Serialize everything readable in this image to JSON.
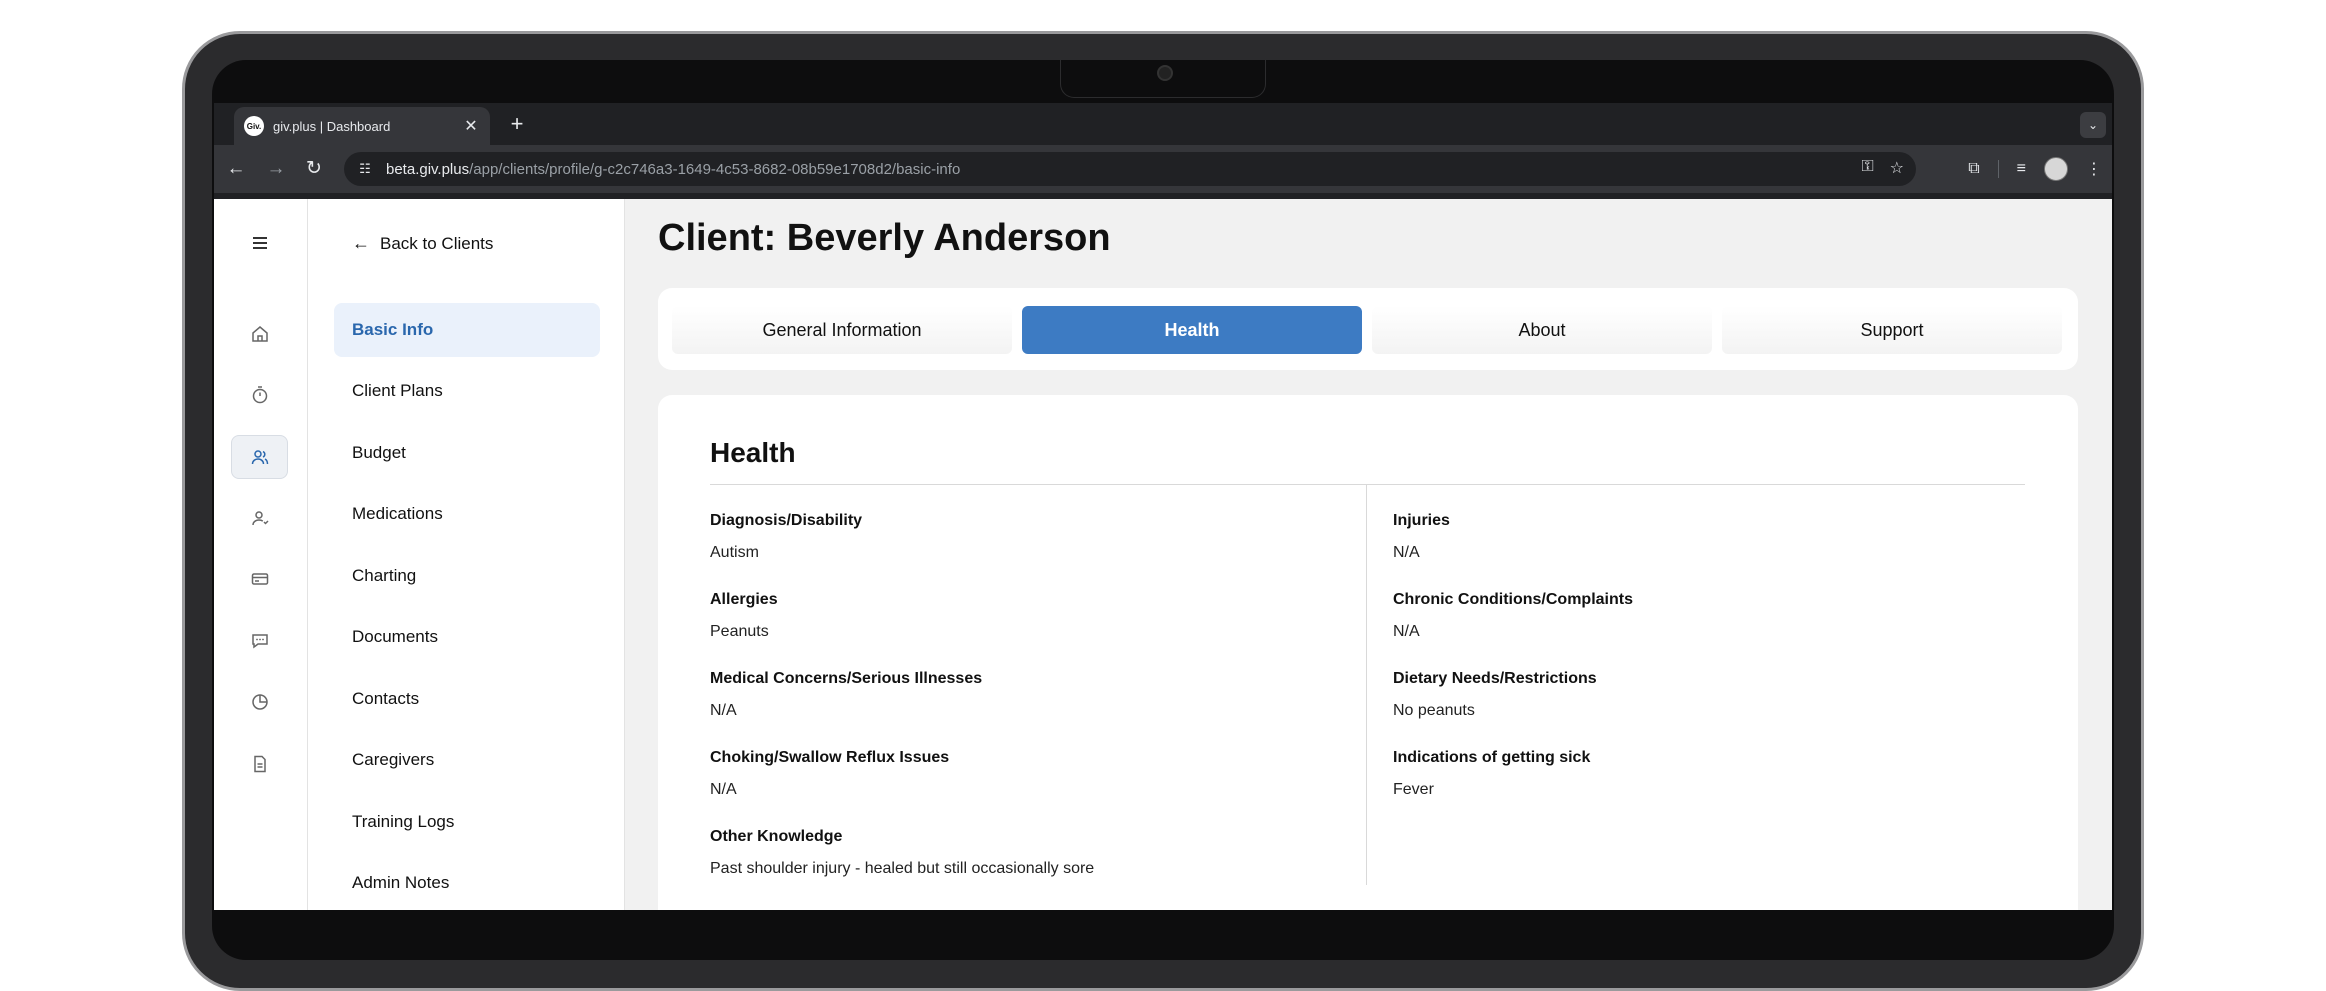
{
  "browser": {
    "tab_title": "giv.plus | Dashboard",
    "favicon_text": "Giv.",
    "url_host": "beta.giv.plus",
    "url_path": "/app/clients/profile/g-c2c746a3-1649-4c53-8682-08b59e1708d2/basic-info"
  },
  "subnav": {
    "back_label": "Back to Clients",
    "items": [
      {
        "label": "Basic Info",
        "active": true
      },
      {
        "label": "Client Plans"
      },
      {
        "label": "Budget"
      },
      {
        "label": "Medications"
      },
      {
        "label": "Charting"
      },
      {
        "label": "Documents"
      },
      {
        "label": "Contacts"
      },
      {
        "label": "Caregivers"
      },
      {
        "label": "Training Logs"
      },
      {
        "label": "Admin Notes"
      }
    ]
  },
  "rail": {
    "icons": [
      "menu-icon",
      "home-icon",
      "timer-icon",
      "clients-icon",
      "person-icon",
      "card-icon",
      "chat-icon",
      "pie-chart-icon",
      "document-icon"
    ],
    "active": "clients-icon"
  },
  "main": {
    "title": "Client: Beverly Anderson",
    "tabs": [
      {
        "label": "General Information"
      },
      {
        "label": "Health",
        "active": true
      },
      {
        "label": "About"
      },
      {
        "label": "Support"
      }
    ],
    "section_title": "Health",
    "left_fields": [
      {
        "label": "Diagnosis/Disability",
        "value": "Autism"
      },
      {
        "label": "Allergies",
        "value": "Peanuts"
      },
      {
        "label": "Medical Concerns/Serious Illnesses",
        "value": "N/A"
      },
      {
        "label": "Choking/Swallow Reflux Issues",
        "value": "N/A"
      },
      {
        "label": "Other Knowledge",
        "value": "Past shoulder injury - healed but still occasionally sore"
      }
    ],
    "right_fields": [
      {
        "label": "Injuries",
        "value": "N/A"
      },
      {
        "label": "Chronic Conditions/Complaints",
        "value": "N/A"
      },
      {
        "label": "Dietary Needs/Restrictions",
        "value": "No peanuts"
      },
      {
        "label": "Indications of getting sick",
        "value": "Fever"
      }
    ]
  },
  "colors": {
    "accent": "#3d7bc3",
    "active_nav_bg": "#eaf1fb",
    "active_nav_text": "#2a67ad",
    "page_bg": "#f1f1f1"
  }
}
